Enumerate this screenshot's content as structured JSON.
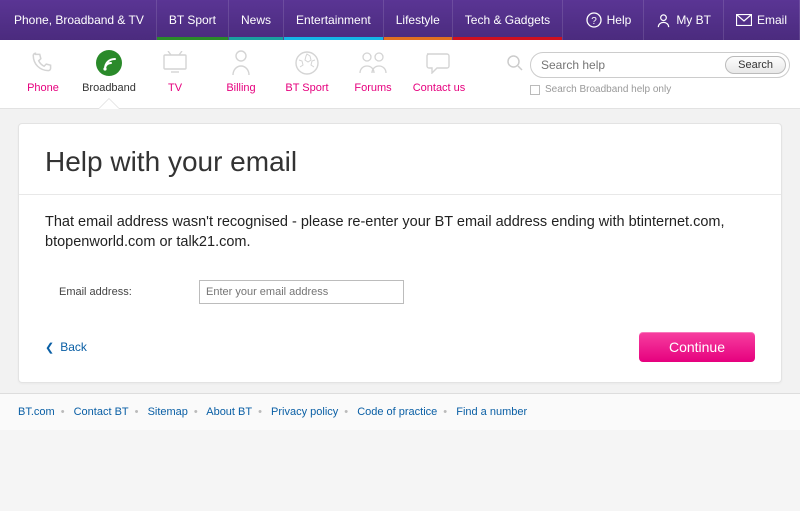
{
  "topnav": {
    "items": [
      {
        "label": "Phone, Broadband & TV"
      },
      {
        "label": "BT Sport"
      },
      {
        "label": "News"
      },
      {
        "label": "Entertainment"
      },
      {
        "label": "Lifestyle"
      },
      {
        "label": "Tech & Gadgets"
      }
    ],
    "help": "Help",
    "mybt": "My BT",
    "email": "Email"
  },
  "secnav": {
    "items": [
      {
        "label": "Phone"
      },
      {
        "label": "Broadband"
      },
      {
        "label": "TV"
      },
      {
        "label": "Billing"
      },
      {
        "label": "BT Sport"
      },
      {
        "label": "Forums"
      },
      {
        "label": "Contact us"
      }
    ]
  },
  "search": {
    "placeholder": "Search help",
    "button": "Search",
    "broadband_only": "Search Broadband help only"
  },
  "page": {
    "title": "Help with your email",
    "error": "That email address wasn't recognised - please re-enter your BT email address ending with btinternet.com, btopenworld.com or talk21.com.",
    "email_label": "Email address:",
    "email_placeholder": "Enter your email address",
    "back": "Back",
    "continue": "Continue"
  },
  "footer": {
    "links": [
      "BT.com",
      "Contact BT",
      "Sitemap",
      "About BT",
      "Privacy policy",
      "Code of practice",
      "Find a number"
    ]
  }
}
